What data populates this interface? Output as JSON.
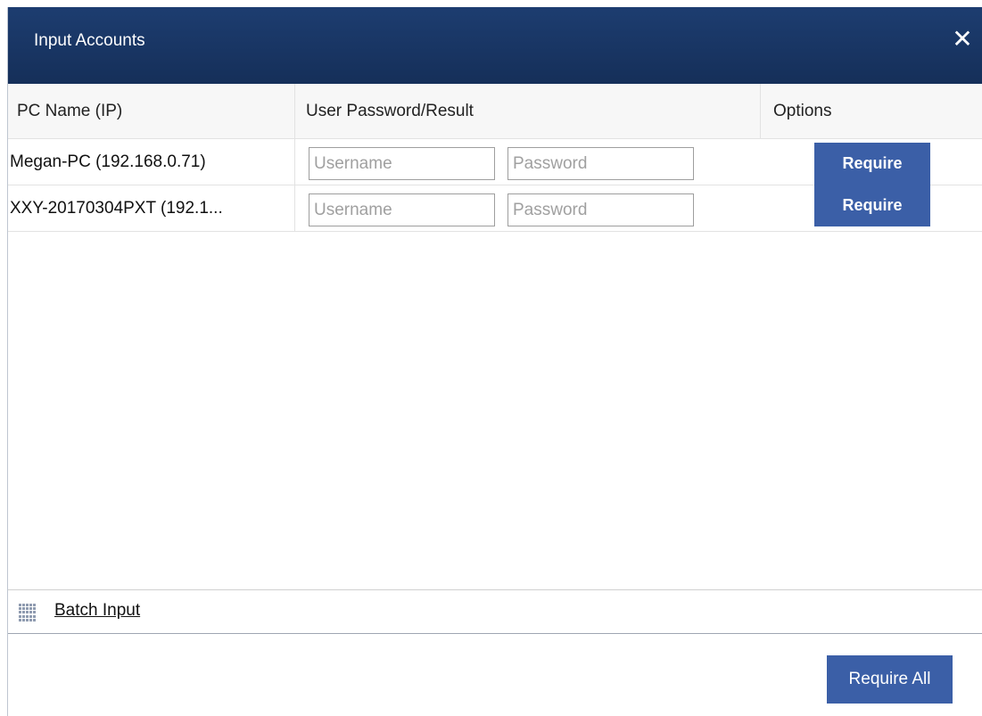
{
  "dialog": {
    "title": "Input Accounts",
    "close_icon": "close-icon"
  },
  "table": {
    "columns": [
      "PC Name (IP)",
      "User Password/Result",
      "Options"
    ],
    "rows": [
      {
        "pc_name": "Megan-PC (192.168.0.71)",
        "username_value": "",
        "username_placeholder": "Username",
        "password_value": "",
        "password_placeholder": "Password",
        "action_label": "Require"
      },
      {
        "pc_name": "XXY-20170304PXT (192.1...",
        "username_value": "",
        "username_placeholder": "Username",
        "password_value": "",
        "password_placeholder": "Password",
        "action_label": "Require"
      }
    ]
  },
  "footer": {
    "batch_icon": "grid-icon",
    "batch_label": "Batch Input",
    "require_all_label": "Require All"
  },
  "colors": {
    "titlebar": "#1a3766",
    "button": "#3b5fa7"
  }
}
